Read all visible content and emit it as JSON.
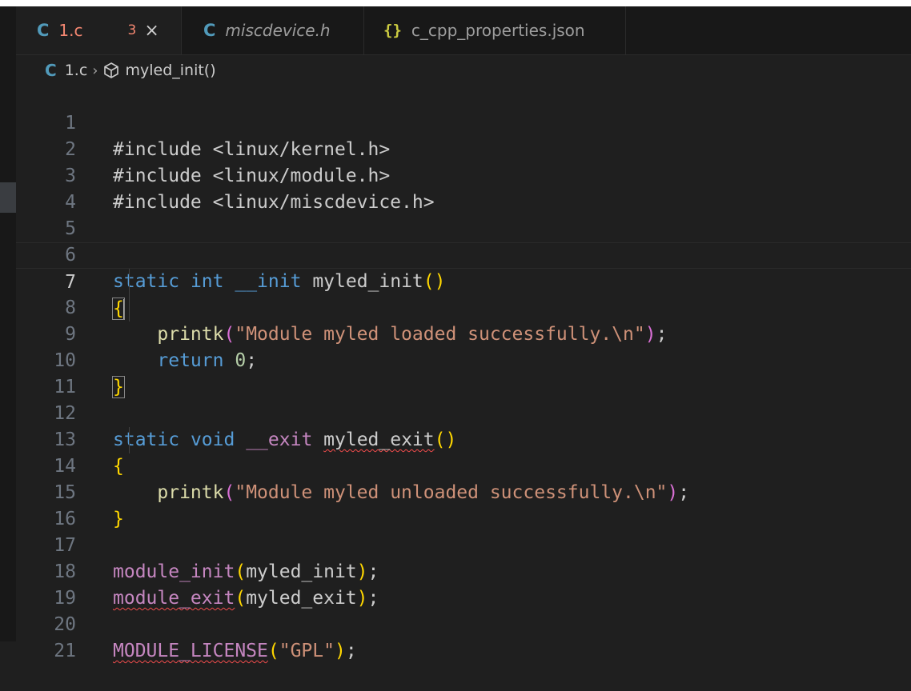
{
  "tabs": [
    {
      "icon": "C",
      "label": "1.c",
      "badge": "3",
      "close": "×",
      "active": true
    },
    {
      "icon": "C",
      "label": "miscdevice.h",
      "italic": true
    },
    {
      "icon": "{}",
      "label": "c_cpp_properties.json"
    }
  ],
  "breadcrumb": {
    "icon": "C",
    "file": "1.c",
    "separator": "›",
    "symbol": "myled_init()"
  },
  "line_numbers": [
    "1",
    "2",
    "3",
    "4",
    "5",
    "6",
    "7",
    "8",
    "9",
    "10",
    "11",
    "12",
    "13",
    "14",
    "15",
    "16",
    "17",
    "18",
    "19",
    "20",
    "21"
  ],
  "code": {
    "inc1": "#include <linux/kernel.h>",
    "inc2": "#include <linux/module.h>",
    "inc3": "#include <linux/miscdevice.h>",
    "kw_static": "static",
    "kw_int": "int",
    "kw_void": "void",
    "mac_init": "__init",
    "mac_exit": "__exit",
    "fn_init": "myled_init",
    "fn_exit": "myled_exit",
    "paren_pair": "()",
    "open_brace": "{",
    "close_brace": "}",
    "printk": "printk",
    "str_loaded": "\"Module myled loaded successfully.\\n\"",
    "str_unloaded": "\"Module myled unloaded successfully.\\n\"",
    "kw_return": "return",
    "num_zero": "0",
    "semicolon": ";",
    "mod_init": "module_init",
    "mod_exit": "module_exit",
    "mod_license": "MODULE_LICENSE",
    "str_gpl": "\"GPL\"",
    "open_paren": "(",
    "close_paren": ")"
  },
  "colors": {
    "background": "#1f1f1f",
    "keyword": "#569cd6",
    "function": "#dcdcaa",
    "string": "#ce9178",
    "macro": "#c586c0",
    "bracket": "#ffd700",
    "error_squiggle": "#f14c4c"
  }
}
